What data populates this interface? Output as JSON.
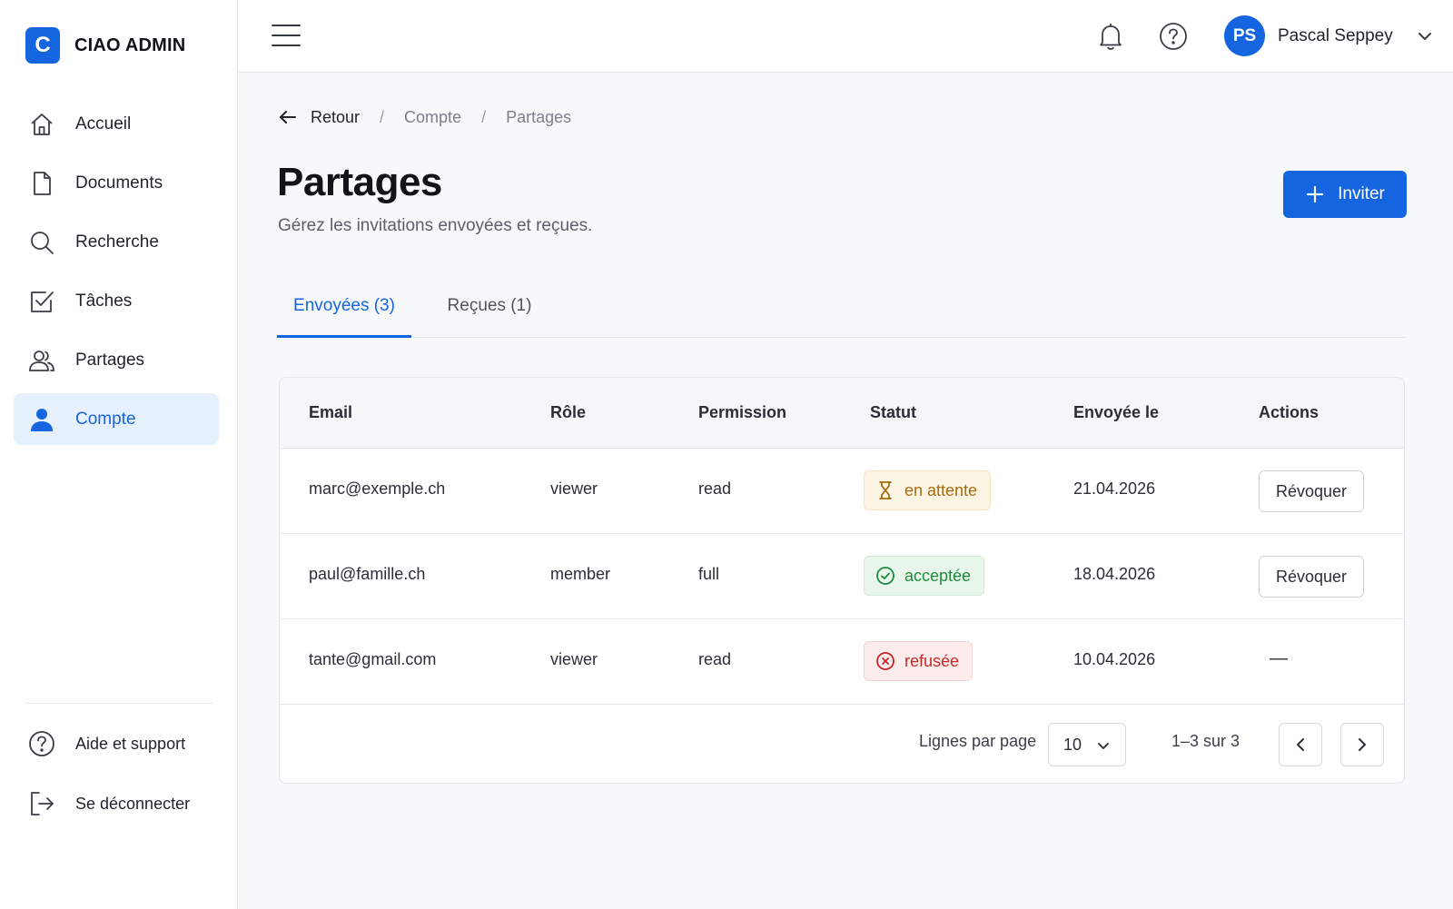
{
  "brand": {
    "logo_letter": "C",
    "name": "CIAO ADMIN",
    "accent_color": "#1565e0"
  },
  "sidebar": {
    "items": [
      {
        "label": "Accueil",
        "icon": "home-icon"
      },
      {
        "label": "Documents",
        "icon": "document-icon"
      },
      {
        "label": "Recherche",
        "icon": "search-icon"
      },
      {
        "label": "Tâches",
        "icon": "checkbox-icon"
      },
      {
        "label": "Partages",
        "icon": "users-icon"
      },
      {
        "label": "Compte",
        "icon": "user-icon",
        "active": true
      }
    ],
    "bottom_items": [
      {
        "label": "Aide et support",
        "icon": "help-circle-icon"
      },
      {
        "label": "Se déconnecter",
        "icon": "logout-icon"
      }
    ]
  },
  "topbar": {
    "user_initials": "PS",
    "user_name": "Pascal Seppey"
  },
  "breadcrumb": {
    "back": "Retour",
    "items": [
      "Compte",
      "Partages"
    ],
    "separator": "/"
  },
  "page": {
    "title": "Partages",
    "subtitle": "Gérez les invitations envoyées et reçues.",
    "invite_label": "Inviter"
  },
  "tabs": [
    {
      "label": "Envoyées (3)",
      "active": true
    },
    {
      "label": "Reçues (1)",
      "active": false
    }
  ],
  "table": {
    "headers": [
      "Email",
      "Rôle",
      "Permission",
      "Statut",
      "Envoyée le",
      "Actions"
    ],
    "rows": [
      {
        "email": "marc@exemple.ch",
        "role": "viewer",
        "permission": "read",
        "status": "en attente",
        "status_kind": "pending",
        "date": "21.04.2026",
        "action": "Révoquer"
      },
      {
        "email": "paul@famille.ch",
        "role": "member",
        "permission": "full",
        "status": "acceptée",
        "status_kind": "accepted",
        "date": "18.04.2026",
        "action": "Révoquer"
      },
      {
        "email": "tante@gmail.com",
        "role": "viewer",
        "permission": "read",
        "status": "refusée",
        "status_kind": "declined",
        "date": "10.04.2026",
        "action": "—"
      }
    ],
    "status_colors": {
      "pending": "#a66a0e",
      "accepted": "#1e8a3e",
      "declined": "#c62828"
    }
  },
  "pagination": {
    "rows_label": "Lignes par page",
    "rows_value": "10",
    "range": "1–3 sur 3"
  }
}
